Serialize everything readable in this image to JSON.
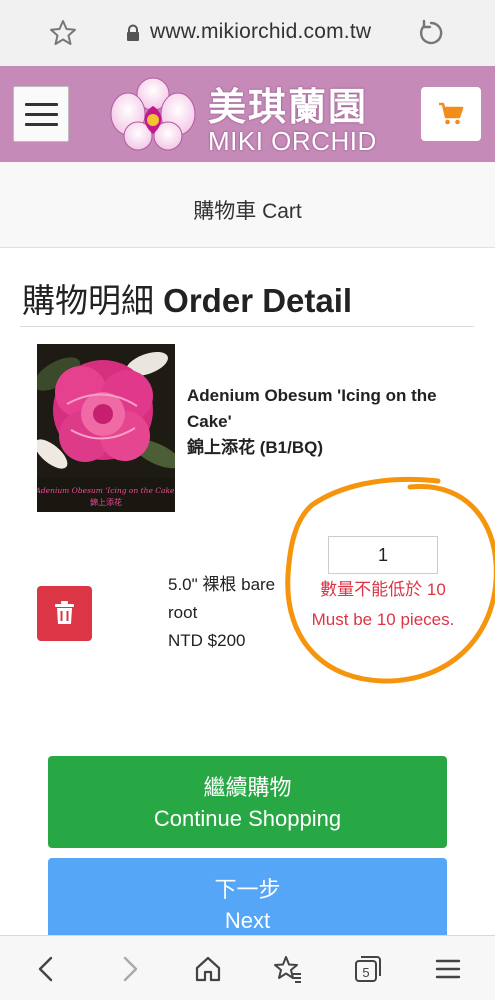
{
  "browser": {
    "url": "www.mikiorchid.com.tw"
  },
  "site": {
    "logo_cn": "美琪蘭園",
    "logo_en": "MIKI ORCHID",
    "accent_color": "#c58ab8",
    "cart_icon_color": "#f28c1a"
  },
  "page": {
    "title": "購物車 Cart"
  },
  "order": {
    "title_cn": "購物明細",
    "title_en": "Order Detail",
    "item": {
      "image_caption": "Adenium Obesum 'Icing on the Cake' 錦上添花",
      "name_en": "Adenium Obesum 'Icing on the Cake'",
      "name_cn": "錦上添花 (B1/BQ)",
      "spec": "5.0\" 裸根 bare root",
      "price": "NTD $200",
      "quantity": "1",
      "error_cn": "數量不能低於 10",
      "error_en": "Must be 10 pieces."
    }
  },
  "buttons": {
    "continue_cn": "繼續購物",
    "continue_en": "Continue Shopping",
    "next_cn": "下一步",
    "next_en": "Next"
  },
  "bottom_nav": {
    "tab_count": "5"
  }
}
